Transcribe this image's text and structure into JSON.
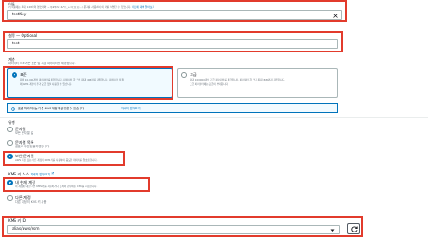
{
  "name_field": {
    "label": "이름",
    "desc": "키 이름에는 최대 128자의 영숫자와 ~!@#$%^&*()_+-=[]{}|:;,./ 문자를 사용하여 이 키를 식별할 수 있습니다.",
    "link": "태그에 대해 알아보기",
    "value": "testKey"
  },
  "desc_field": {
    "label": "설명 — Optional",
    "value": "test"
  },
  "tier": {
    "label": "계층",
    "desc": "파라미터 스토어는 표준 및 고급 파라미터를 제공합니다.",
    "standard": {
      "title": "표준",
      "desc1": "최대 10,000개의 파라미터를 제한합니다. 파라미터 값 크기 최대 4KB까지 지원합니다. 파라미터 정책",
      "desc2": "에 AWS 계정의 추가 요금 없이 사용할 수 있습니다."
    },
    "advanced": {
      "title": "고급",
      "desc1": "최대 100,000개의 고급 파라미터를 제한합니다. 파라미터 값 크기 최대 8KB까지 지원합니다.",
      "desc2": "고급 파라미터에는 요금이 부과됩니다."
    }
  },
  "notice": {
    "text": "표준 파라미터는 다른 AWS 계정과 공유할 수 있습니다.",
    "link": "자세히 알아보기"
  },
  "type": {
    "label": "유형",
    "options": [
      {
        "title": "문자열",
        "desc": "모든 문자열 값"
      },
      {
        "title": "문자열 목록",
        "desc": "쉼표로 구분된 문자열입니다."
      },
      {
        "title": "보안 문자열",
        "desc": "AWS 계정 또는 다른 계정의 KMS 키를 사용하여 중요한 데이터를 암호화합니다."
      }
    ]
  },
  "kms_source": {
    "label": "KMS 키 소스",
    "link": "자세히 알아보기",
    "options": [
      {
        "title": "내 현재 계정",
        "desc": "이 계정에 대한 기본 KMS 키를 사용하거나 고객이 관리하는 CMK를 지정합니다."
      },
      {
        "title": "다른 계정",
        "desc": "다른 계정의 KMS 키 사용"
      }
    ]
  },
  "kms_key": {
    "label": "KMS 키 ID",
    "value": "alias/aws/ssm"
  },
  "colors": {
    "highlight": "#e23b2c",
    "accent": "#0073bb",
    "border": "#aab7b8"
  }
}
